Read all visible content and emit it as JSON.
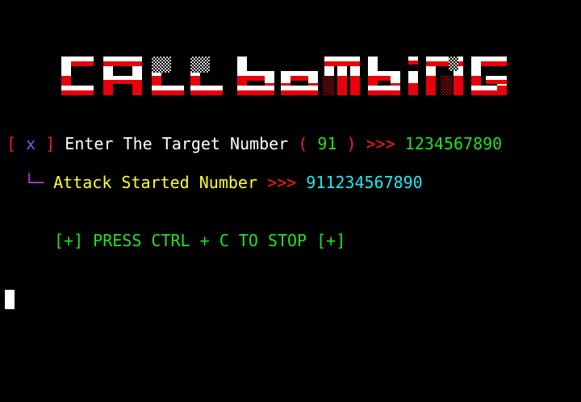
{
  "banner": {
    "text": "CALL BOMBING",
    "top_color": "#ffffff",
    "bottom_color": "#e8000b"
  },
  "prompt": {
    "bracket_open": "[",
    "marker": "x",
    "bracket_close": "]",
    "label": "Enter The Target Number",
    "paren_open": "(",
    "country_code": "91",
    "paren_close": ")",
    "arrows": ">>>",
    "input_value": "1234567890"
  },
  "status": {
    "tree_glyph": "└─",
    "label": "Attack Started Number",
    "arrows": ">>>",
    "number": "911234567890"
  },
  "hint": {
    "text": "[+] PRESS CTRL + C TO STOP [+]"
  },
  "colors": {
    "background": "#000000",
    "red": "#ff1a1a",
    "blue": "#5b6cff",
    "green": "#22e022",
    "yellow": "#ffff33",
    "cyan": "#22e8f0",
    "magenta": "#cc33ff"
  }
}
